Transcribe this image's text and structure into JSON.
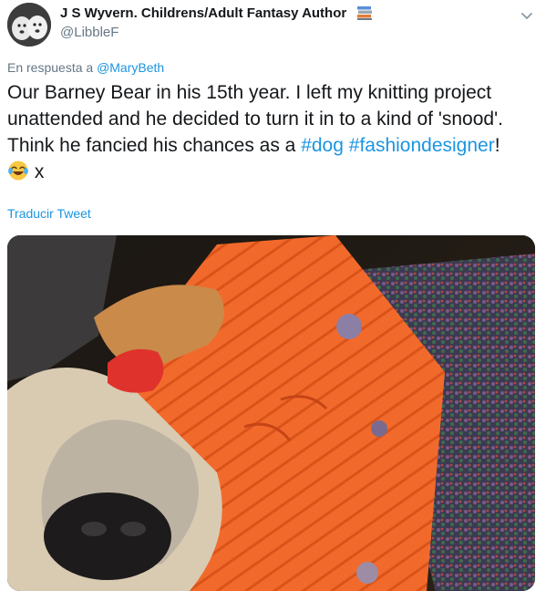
{
  "author": {
    "display_name": "J S Wyvern. Childrens/Adult Fantasy Author",
    "handle": "@LibbleF",
    "name_emoji": "books-icon"
  },
  "reply": {
    "prefix": "En respuesta a",
    "mention": "@MaryBeth"
  },
  "tweet": {
    "text_1": "Our Barney Bear in his 15th year. I left my knitting project unattended and he decided to turn it in to a kind of 'snood'. Think he fancied his chances as a ",
    "hashtag_1": "#dog",
    "space": " ",
    "hashtag_2": "#fashiondesigner",
    "text_2": "!",
    "emoji": "laughing-tears-icon",
    "text_3": " x"
  },
  "translate_label": "Traducir Tweet",
  "colors": {
    "link": "#1b95e0",
    "muted": "#657786",
    "text": "#14171a"
  }
}
